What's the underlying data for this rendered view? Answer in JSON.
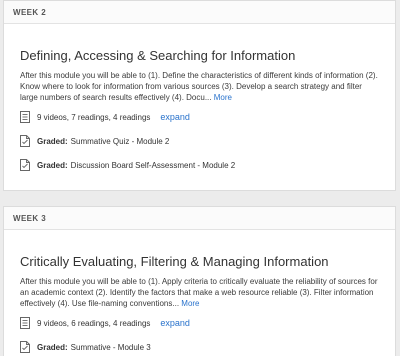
{
  "weeks": [
    {
      "label": "WEEK 2",
      "title": "Defining, Accessing & Searching for Information",
      "description": "After this module you will be able to (1). Define the characteristics of different kinds of information (2). Know where to look for information from various sources (3). Develop a search strategy and filter large numbers of search results effectively (4). Docu...",
      "more_label": "More",
      "stats": "9 videos, 7 readings, 4 readings",
      "expand_label": "expand",
      "graded": [
        {
          "prefix": "Graded:",
          "text": "Summative Quiz - Module 2"
        },
        {
          "prefix": "Graded:",
          "text": "Discussion Board Self-Assessment - Module 2"
        }
      ]
    },
    {
      "label": "WEEK 3",
      "title": "Critically Evaluating, Filtering & Managing Information",
      "description": "After this module you will be able to (1). Apply criteria to critically evaluate the reliability of sources for an academic context (2). Identify the factors that make a web resource reliable (3). Filter information effectively (4). Use file-naming conventions...",
      "more_label": "More",
      "stats": "9 videos, 6 readings, 4 readings",
      "expand_label": "expand",
      "graded": [
        {
          "prefix": "Graded:",
          "text": "Summative - Module 3"
        }
      ]
    }
  ],
  "colors": {
    "link": "#2a73cc",
    "background": "#ececec",
    "card": "#ffffff"
  },
  "icons": {
    "stats": "document-list-icon",
    "graded": "graded-page-icon"
  }
}
